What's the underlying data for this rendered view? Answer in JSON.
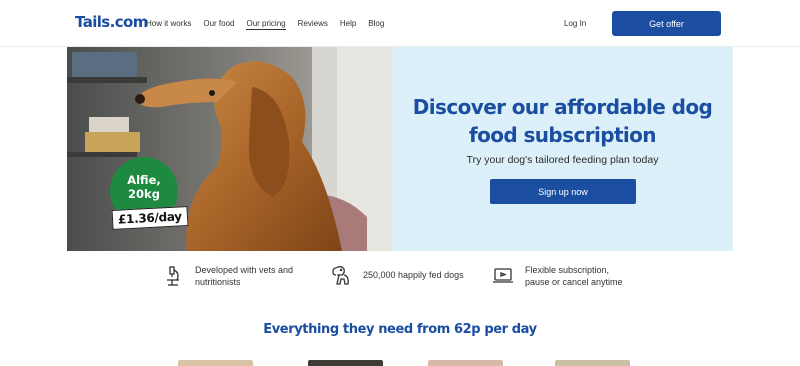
{
  "header": {
    "logo": "Tails.com",
    "nav": [
      "How it works",
      "Our food",
      "Our pricing",
      "Reviews",
      "Help",
      "Blog"
    ],
    "active_nav": "Our pricing",
    "login": "Log In",
    "offer_button": "Get offer"
  },
  "hero": {
    "title_line1": "Discover our affordable dog",
    "title_line2": "food subscription",
    "subtitle": "Try your dog's tailored feeding plan today",
    "signup_button": "Sign up now",
    "badge_name": "Alfie,",
    "badge_weight": "20kg",
    "price_tag": "£1.36/day"
  },
  "features": [
    {
      "icon": "microscope-icon",
      "line1": "Developed with vets and",
      "line2": "nutritionists"
    },
    {
      "icon": "dog-icon",
      "line1": "250,000 happily fed dogs",
      "line2": ""
    },
    {
      "icon": "laptop-icon",
      "line1": "Flexible subscription,",
      "line2": "pause or cancel anytime"
    }
  ],
  "section_title": "Everything they need from 62p per day",
  "colors": {
    "brand_blue": "#1b4ea0",
    "hero_bg": "#dcf0fa",
    "badge_green": "#1d8a3f"
  }
}
